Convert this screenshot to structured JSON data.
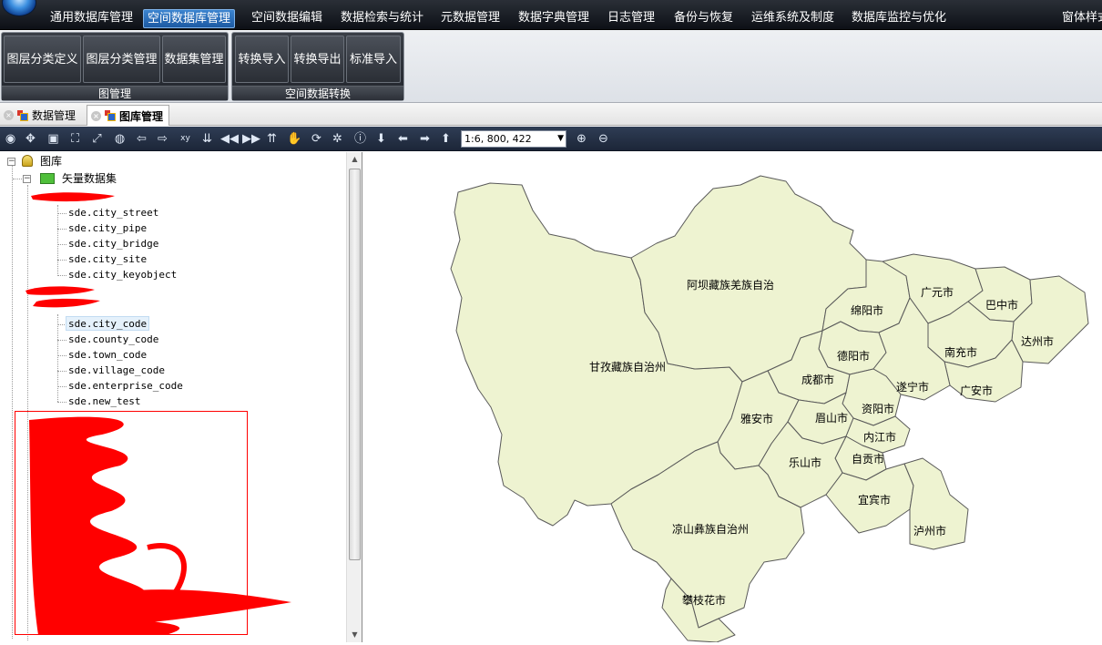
{
  "menu": {
    "items": [
      {
        "label": "通用数据库管理"
      },
      {
        "label": "空间数据库管理",
        "active": true
      },
      {
        "label": "空间数据编辑"
      },
      {
        "label": "数据检索与统计"
      },
      {
        "label": "元数据管理"
      },
      {
        "label": "数据字典管理"
      },
      {
        "label": "日志管理"
      },
      {
        "label": "备份与恢复"
      },
      {
        "label": "运维系统及制度"
      },
      {
        "label": "数据库监控与优化"
      }
    ],
    "right_label": "窗体样式"
  },
  "ribbon": {
    "groups": [
      {
        "title": "图管理",
        "buttons": [
          "图层分类定义",
          "图层分类管理",
          "数据集管理"
        ]
      },
      {
        "title": "空间数据转换",
        "buttons": [
          "转换导入",
          "转换导出",
          "标准导入"
        ]
      }
    ]
  },
  "tabs": [
    {
      "label": "数据管理",
      "active": false
    },
    {
      "label": "图库管理",
      "active": true
    }
  ],
  "toolbar": {
    "scale_value": "1:6, 800, 422",
    "icons": [
      "full-extent-icon",
      "pan-center-icon",
      "map-layers-icon",
      "zoom-box-icon",
      "zoom-extent-icon",
      "globe-icon",
      "back-icon",
      "forward-icon",
      "xy-coordinate-icon",
      "move-down-icon",
      "first-icon",
      "last-icon",
      "move-up-icon",
      "hand-pan-icon",
      "refresh-icon",
      "settings-icon",
      "identify-icon",
      "arrow-down-icon",
      "arrow-left-icon",
      "arrow-right-icon",
      "arrow-up-icon"
    ]
  },
  "tree": {
    "root": "图库",
    "dataset": "矢量数据集",
    "group1_items": [
      "sde.city_street",
      "sde.city_pipe",
      "sde.city_bridge",
      "sde.city_site",
      "sde.city_keyobject"
    ],
    "group2_items": [
      "sde.city_code",
      "sde.county_code",
      "sde.town_code",
      "sde.village_code",
      "sde.enterprise_code",
      "sde.new_test"
    ],
    "selected": "sde.city_code"
  },
  "map": {
    "fill_color": "#eef3d1",
    "border_color": "#5a5a5a",
    "regions": [
      "阿坝藏族羌族自治",
      "甘孜藏族自治州",
      "绵阳市",
      "广元市",
      "巴中市",
      "达州市",
      "南充市",
      "德阳市",
      "成都市",
      "遂宁市",
      "广安市",
      "资阳市",
      "雅安市",
      "眉山市",
      "内江市",
      "自贡市",
      "乐山市",
      "宜宾市",
      "凉山彝族自治州",
      "泸州市",
      "攀枝花市"
    ]
  }
}
